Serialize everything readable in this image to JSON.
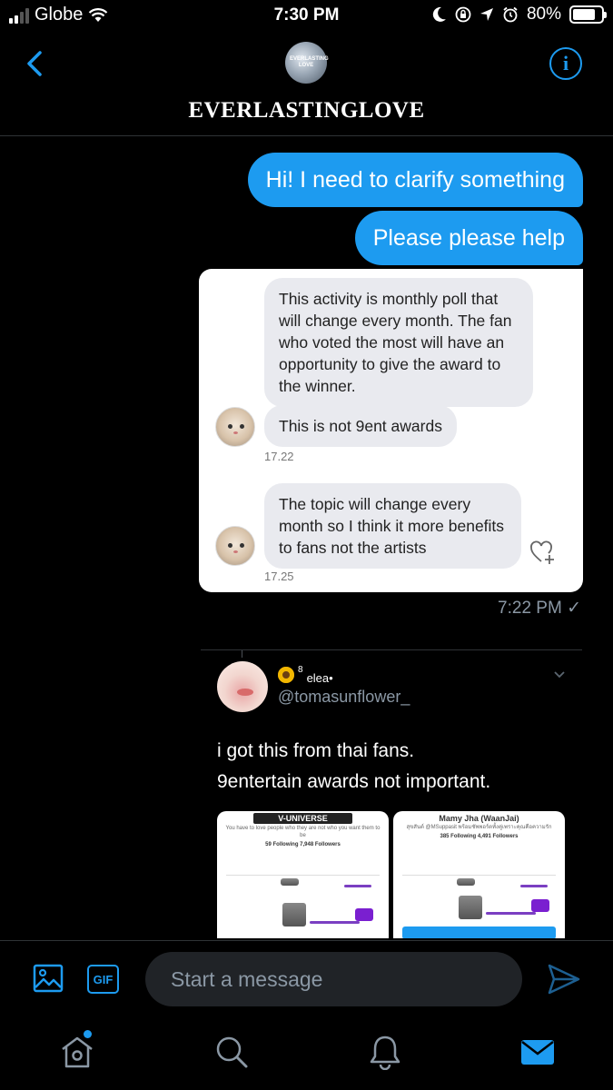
{
  "status_bar": {
    "carrier": "Globe",
    "time": "7:30 PM",
    "battery": "80%",
    "battery_level": 0.8
  },
  "header": {
    "avatar_text": "EVERLASTING LOVE",
    "title": "EVERLASTINGLOVE",
    "info_icon": "info-icon",
    "back_icon": "chevron-left-icon"
  },
  "messages": {
    "out1": "Hi! I need to clarify something",
    "out2": "Please please help",
    "sent_time": "7:22 PM ✓"
  },
  "screenshot": {
    "msg1": "This activity is monthly poll that will change every month. The fan who voted the most will have an opportunity to give the award to the winner.",
    "msg2": "This is not 9ent awards",
    "time1": "17.22",
    "msg3": "The topic will change every month so I think it more benefits to fans not the artists",
    "time2": "17.25"
  },
  "tweet": {
    "sup": "8",
    "name": "elea•",
    "handle": "@tomasunflower_",
    "line1": "i got this from thai fans.",
    "line2": "9entertain awards not important.",
    "media1_title": "V-UNIVERSE",
    "media1_sub": "You have to love people who they are not who you want them to be",
    "media1_stats": "59 Following 7,948 Followers",
    "media2_title": "Mamy Jha (WaanJai)",
    "media2_sub": "สุขสันต์ @MSuppasit พร้อมชัพพอร์ตทั้งคู่เพราะคุณคือความรัก",
    "media2_stats": "385 Following 4,491 Followers"
  },
  "composer": {
    "placeholder": "Start a message",
    "gif_label": "GIF"
  },
  "tabs": [
    "home-icon",
    "search-icon",
    "bell-icon",
    "mail-icon"
  ],
  "colors": {
    "accent": "#1d9bf0",
    "background": "#000000",
    "input_bg": "#202327"
  }
}
